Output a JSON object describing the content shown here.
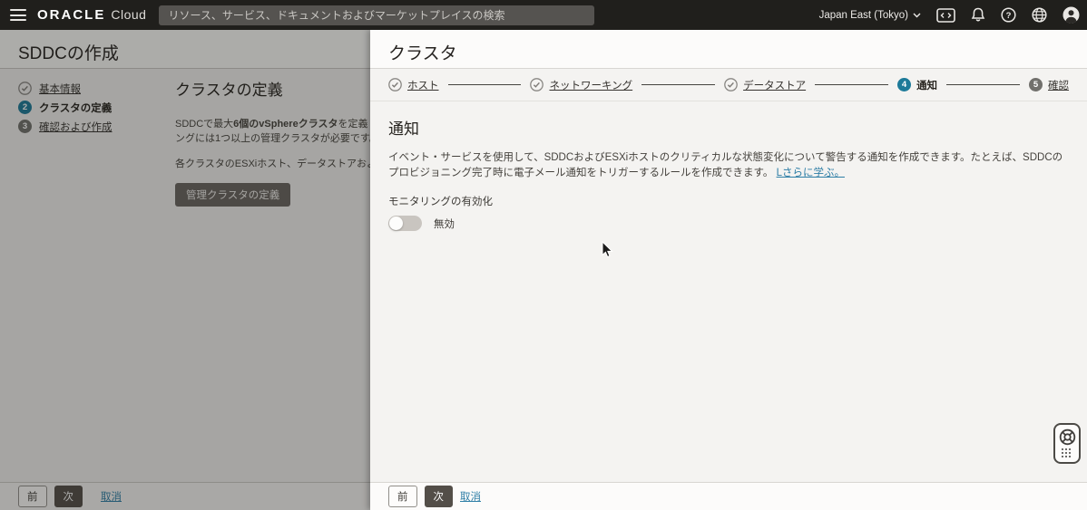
{
  "topbar": {
    "logo_primary": "ORACLE",
    "logo_secondary": "Cloud",
    "search_placeholder": "リソース、サービス、ドキュメントおよびマーケットプレイスの検索",
    "region_label": "Japan East (Tokyo)"
  },
  "colors": {
    "accent_teal": "#1d7a99",
    "link": "#2e7ea6",
    "topbar_bg": "#201f1c"
  },
  "left_panel": {
    "title": "SDDCの作成",
    "steps": [
      {
        "label": "基本情報",
        "state": "done"
      },
      {
        "number": "2",
        "label": "クラスタの定義",
        "state": "current"
      },
      {
        "number": "3",
        "label": "確認および作成",
        "state": "upcoming"
      }
    ],
    "content": {
      "heading": "クラスタの定義",
      "p1_pre": "SDDCで最大",
      "p1_bold": "6個のvSphereクラスタ",
      "p1_post": "を定義します。ク",
      "p1_line2": "ングには1つ以上の管理クラスタが必要です。",
      "p2": "各クラスタのESXiホスト、データストアおよびネット",
      "define_button": "管理クラスタの定義"
    },
    "footer": {
      "previous": "前",
      "next": "次",
      "cancel": "取消"
    }
  },
  "cluster_panel": {
    "title": "クラスタ",
    "stepper": [
      {
        "label": "ホスト",
        "state": "done"
      },
      {
        "label": "ネットワーキング",
        "state": "done"
      },
      {
        "label": "データストア",
        "state": "done"
      },
      {
        "number": "4",
        "label": "通知",
        "state": "current"
      },
      {
        "number": "5",
        "label": "確認",
        "state": "upcoming"
      }
    ],
    "notifications": {
      "heading": "通知",
      "description": "イベント・サービスを使用して、SDDCおよびESXiホストのクリティカルな状態変化について警告する通知を作成できます。たとえば、SDDCのプロビジョニング完了時に電子メール通知をトリガーするルールを作成できます。",
      "learn_more_link": "Lさらに学ぶ。",
      "monitoring_label": "モニタリングの有効化",
      "toggle_state_label": "無効"
    },
    "footer": {
      "previous": "前",
      "next": "次",
      "cancel": "取消"
    }
  }
}
